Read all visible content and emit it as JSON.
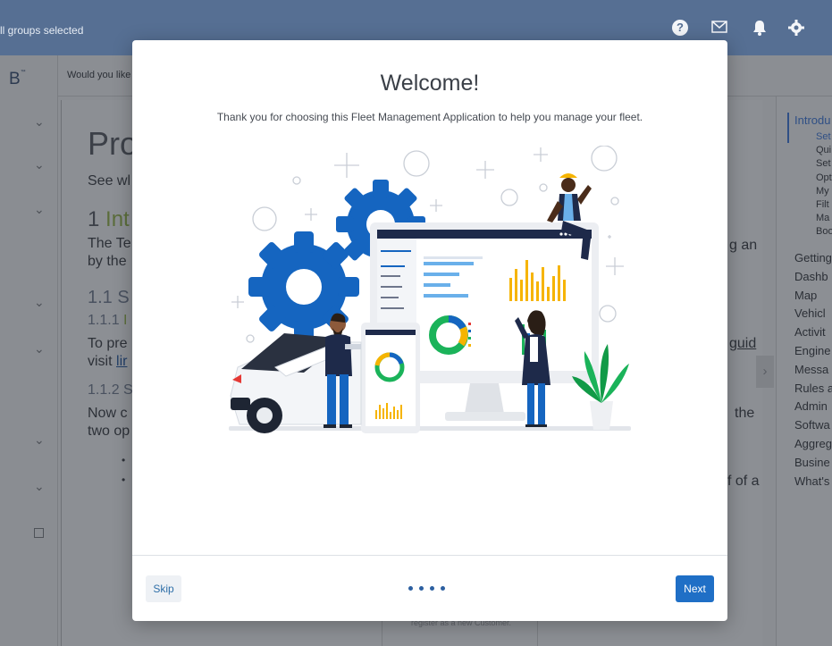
{
  "topbar": {
    "groups_text": "ll groups selected",
    "icons": [
      "help-icon",
      "mail-icon",
      "bell-icon",
      "gear-icon"
    ]
  },
  "brand": {
    "text": "B",
    "mark": "™"
  },
  "subbar": {
    "text": "Would you like"
  },
  "doc": {
    "title": "Pro",
    "line_see": "See wl",
    "h1_num": "1",
    "h1_text": "Int",
    "line_the": "The Te",
    "line_by": "by the",
    "h11": "1.1 S",
    "h111_num": "1.1.1",
    "h111_text": "I",
    "line_topre": "To pre",
    "line_visit": "visit",
    "link_visit": "lir",
    "h112": "1.1.2 S",
    "line_now": "Now c",
    "line_two": "two op",
    "right_an": "g an",
    "right_guid": "guid",
    "right_the": "the",
    "right_ofa": "f of a",
    "bullet": "•",
    "under": "register as a new Customer."
  },
  "toc": {
    "main_items": [
      "Introdu",
      "Getting",
      "Dashb",
      "Map",
      "Vehicl",
      "Activit",
      "Engine",
      "Messa",
      "Rules a",
      "Admin",
      "Softwa",
      "Aggreg",
      "Busine",
      "What's"
    ],
    "sub_items": [
      "Set",
      "Qui",
      "Set",
      "Opt",
      "My",
      "Filt",
      "Ma",
      "Boo"
    ]
  },
  "modal": {
    "title": "Welcome!",
    "subtitle": "Thank you for choosing this Fleet Management Application to help you manage your fleet.",
    "skip_label": "Skip",
    "next_label": "Next",
    "page_dots": 4,
    "illustration": "fleet-management-illustration"
  },
  "colors": {
    "topbar": "#566f93",
    "primary_button": "#1f6fc6",
    "gear_blue": "#1565c0",
    "chart_yellow": "#f6b400",
    "chart_green": "#1bb35a"
  }
}
